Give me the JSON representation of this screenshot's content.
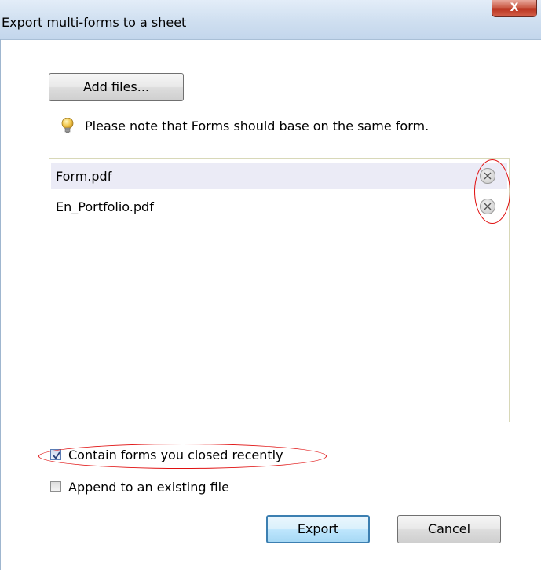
{
  "window": {
    "title": "Export multi-forms to a sheet",
    "close_label": "X"
  },
  "toolbar": {
    "add_files_label": "Add files..."
  },
  "note": {
    "icon": "lightbulb-icon",
    "text": "Please note that Forms should base on the same form."
  },
  "file_list": {
    "items": [
      {
        "name": "Form.pdf",
        "selected": true
      },
      {
        "name": "En_Portfolio.pdf",
        "selected": false
      }
    ]
  },
  "options": {
    "contain_closed": {
      "label": "Contain forms you closed recently",
      "checked": true
    },
    "append_existing": {
      "label": "Append to an existing file",
      "checked": false
    }
  },
  "actions": {
    "export_label": "Export",
    "cancel_label": "Cancel"
  },
  "colors": {
    "annotation_red": "#e01010",
    "selected_row": "#ebebf6",
    "default_button_border": "#3c7fb1"
  }
}
